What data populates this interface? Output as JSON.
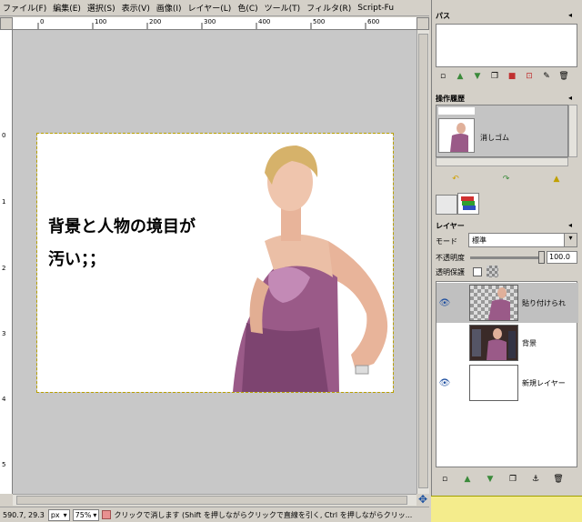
{
  "menu": [
    "ファイル(F)",
    "編集(E)",
    "選択(S)",
    "表示(V)",
    "画像(I)",
    "レイヤー(L)",
    "色(C)",
    "ツール(T)",
    "フィルタ(R)",
    "Script-Fu"
  ],
  "ruler_h_labels": [
    "0",
    "100",
    "200",
    "300",
    "400",
    "500",
    "600"
  ],
  "ruler_v_labels": [
    "0",
    "1",
    "2",
    "3",
    "4",
    "5"
  ],
  "image_text_line1": "背景と人物の境目が",
  "image_text_line2": "汚い；；",
  "status": {
    "coords": "590.7, 29.3",
    "unit": "px",
    "zoom": "75%",
    "message": "クリックで消します (Shift を押しながらクリックで直線を引く, Ctrl を押しながらクリッ..."
  },
  "dock": {
    "paths_title": "パス",
    "undo_title": "操作履歴",
    "undo_item": "消しゴム",
    "layers_title": "レイヤー",
    "mode_label": "モード",
    "mode_value": "標準",
    "opacity_label": "不透明度",
    "opacity_value": "100.0",
    "lock_label": "透明保護",
    "layers": [
      {
        "name": "貼り付けられ"
      },
      {
        "name": "背景"
      },
      {
        "name": "新規レイヤー"
      }
    ]
  },
  "colors": {
    "selection_row": "#c0c0c0",
    "status_bg": "#d4d0c8",
    "tooltip_bg": "#f4ec8c"
  }
}
